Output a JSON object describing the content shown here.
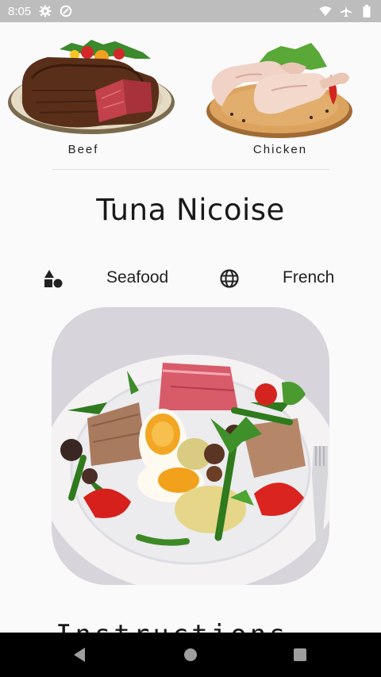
{
  "status_bar": {
    "time": "8:05",
    "icons": [
      "gear-icon",
      "data-saver-icon",
      "wifi-icon",
      "airplane-icon",
      "battery-icon"
    ]
  },
  "categories": [
    {
      "label": "Beef",
      "image": "beef-steak-plate"
    },
    {
      "label": "Chicken",
      "image": "chicken-legs-board"
    }
  ],
  "meal": {
    "title": "Tuna Nicoise",
    "category": "Seafood",
    "category_icon": "category-shapes-icon",
    "area": "French",
    "area_icon": "globe-icon",
    "image": "tuna-nicoise-salad-plate"
  },
  "instructions": {
    "heading": "Instructions"
  },
  "nav_bar": {
    "buttons": [
      "back-button",
      "home-button",
      "recents-button"
    ]
  },
  "colors": {
    "status_bar": "#bdbdbd",
    "background": "#fafafa",
    "nav_bar": "#000000",
    "text": "#222222"
  }
}
